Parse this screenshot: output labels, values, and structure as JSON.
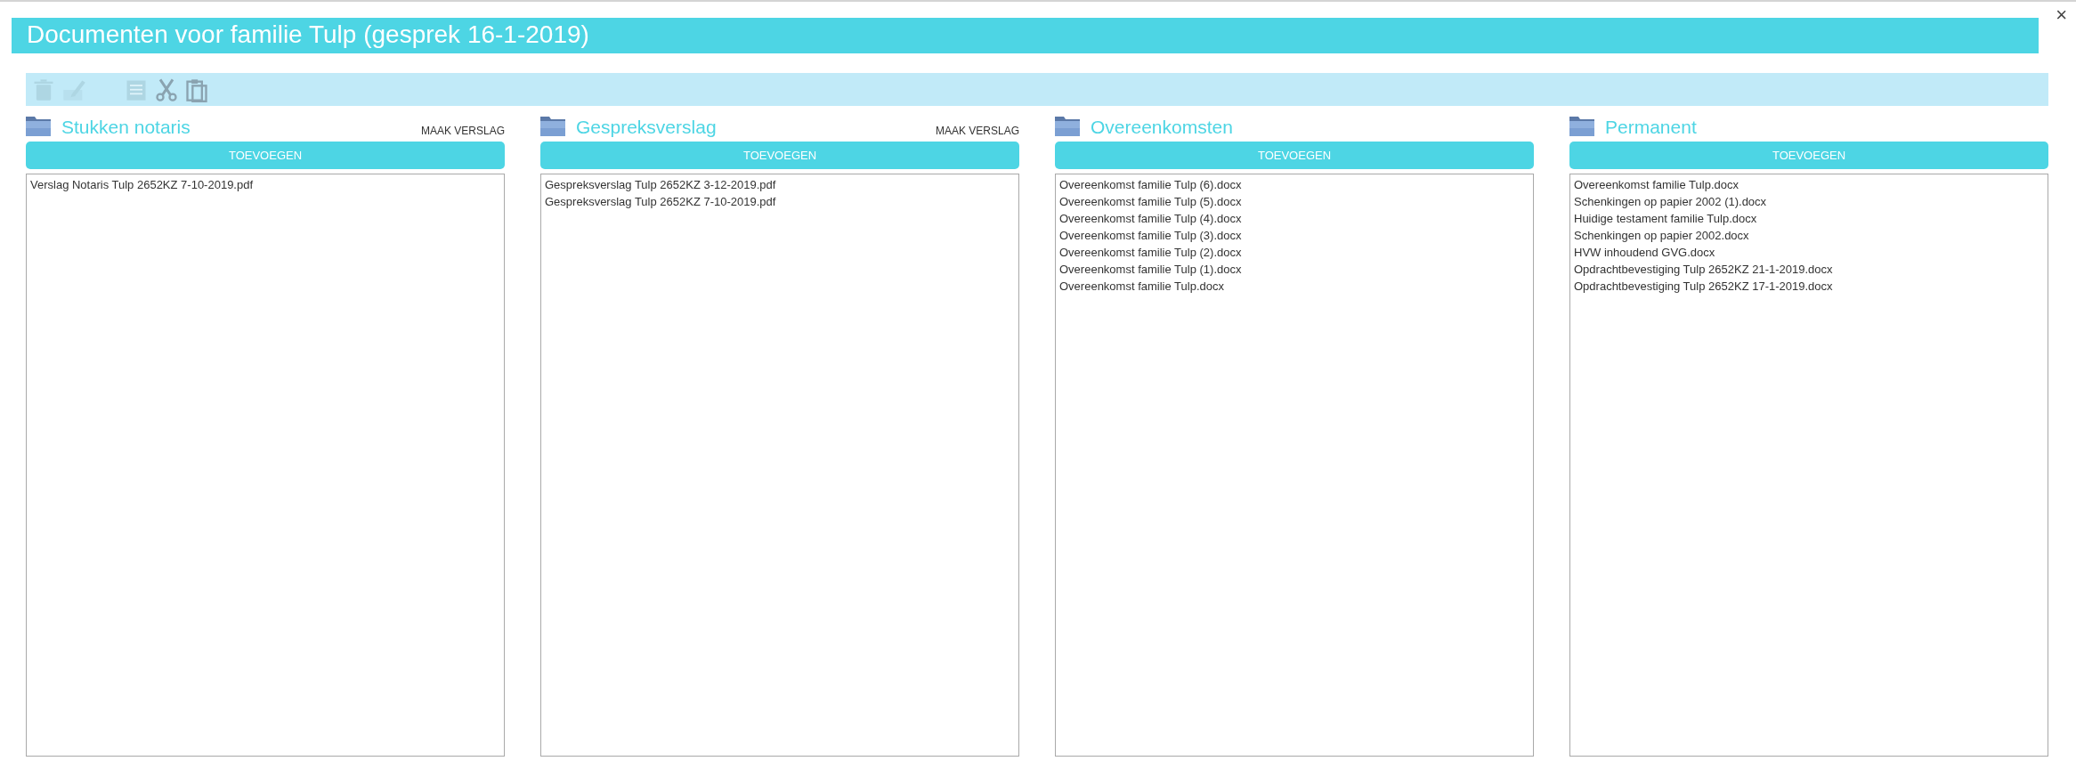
{
  "window": {
    "title": "Documenten voor familie Tulp (gesprek 16-1-2019)",
    "close": "×"
  },
  "toolbar": [
    {
      "kind": "delete",
      "disabled": true
    },
    {
      "kind": "edit",
      "disabled": true
    },
    {
      "kind": "document",
      "disabled": true
    },
    {
      "kind": "cut",
      "disabled": false
    },
    {
      "kind": "paste",
      "disabled": false
    }
  ],
  "columns": [
    {
      "title": "Stukken notaris",
      "action": "MAAK VERSLAG",
      "button": "TOEVOEGEN",
      "files": [
        "Verslag Notaris Tulp 2652KZ 7-10-2019.pdf"
      ]
    },
    {
      "title": "Gespreksverslag",
      "action": "MAAK VERSLAG",
      "button": "TOEVOEGEN",
      "files": [
        "Gespreksverslag Tulp 2652KZ 3-12-2019.pdf",
        "Gespreksverslag Tulp 2652KZ 7-10-2019.pdf"
      ]
    },
    {
      "title": "Overeenkomsten",
      "button": "TOEVOEGEN",
      "files": [
        "Overeenkomst familie Tulp (6).docx",
        "Overeenkomst familie Tulp (5).docx",
        "Overeenkomst familie Tulp (4).docx",
        "Overeenkomst familie Tulp (3).docx",
        "Overeenkomst familie Tulp (2).docx",
        "Overeenkomst familie Tulp (1).docx",
        "Overeenkomst familie Tulp.docx"
      ]
    },
    {
      "title": "Permanent",
      "button": "TOEVOEGEN",
      "files": [
        "Overeenkomst familie Tulp.docx",
        "Schenkingen op papier 2002 (1).docx",
        "Huidige testament familie Tulp.docx",
        "Schenkingen op papier 2002.docx",
        "HVW inhoudend GVG.docx",
        "Opdrachtbevestiging Tulp 2652KZ 21-1-2019.docx",
        "Opdrachtbevestiging Tulp 2652KZ 17-1-2019.docx"
      ]
    }
  ]
}
